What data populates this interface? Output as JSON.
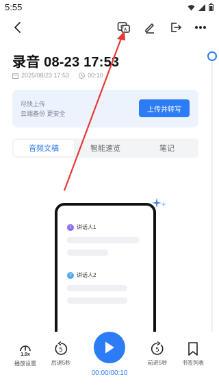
{
  "status": {
    "time": "5:55"
  },
  "toolbar": {
    "back_icon": "arrow-left-icon",
    "transcribe_icon": "translate-icon",
    "edit_icon": "pencil-icon",
    "export_icon": "export-icon",
    "more_icon": "more-dots-icon"
  },
  "recording": {
    "title": "录音 08-23 17:53",
    "date": "2025/08/23 17:53",
    "duration": "00:10"
  },
  "banner": {
    "line1": "尽快上传",
    "line2": "云端备份 更安全",
    "button_label": "上传并转写"
  },
  "tabs": [
    {
      "label": "音频文稿",
      "active": true
    },
    {
      "label": "智能速览",
      "active": false
    },
    {
      "label": "笔记",
      "active": false
    }
  ],
  "illustration": {
    "speakers": [
      {
        "number": "1",
        "label": "讲话人1",
        "color": "#8e6cf0"
      },
      {
        "number": "2",
        "label": "讲话人2",
        "color": "#55a8f0"
      }
    ]
  },
  "player": {
    "speed": "1.0x",
    "items": [
      {
        "label": "播放设置",
        "icon": "speed-icon"
      },
      {
        "label": "后退5秒",
        "icon": "rewind-5-icon"
      },
      {
        "label": "前进5秒",
        "icon": "forward-5-icon"
      },
      {
        "label": "书签列表",
        "icon": "bookmark-icon"
      }
    ],
    "time": "00:00/00:10",
    "rewind_seconds": "5",
    "forward_seconds": "5",
    "progress": 0
  },
  "colors": {
    "accent": "#2b7cf6",
    "arrow": "#e53935"
  }
}
